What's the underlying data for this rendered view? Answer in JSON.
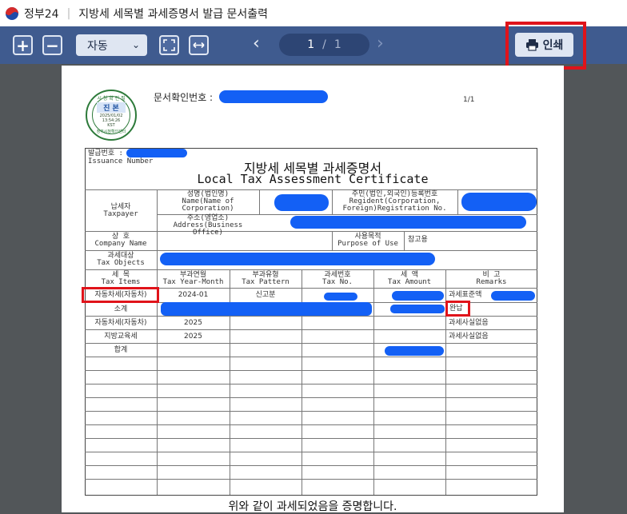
{
  "titlebar": {
    "app": "정부24",
    "doc_title": "지방세 세목별 과세증명서 발급 문서출력"
  },
  "toolbar": {
    "zoom_in": "+",
    "zoom_out": "−",
    "zoom_value": "자동",
    "page_current": "1",
    "page_total": "1",
    "print_label": "인쇄"
  },
  "document": {
    "confirm_label": "문서확인번호 :",
    "page_indicator": "1/1",
    "seal": {
      "top": "시 청 확 인 필",
      "mid": "진 본",
      "date": "2025/01/02",
      "time": "13:54:26",
      "tz": "KST",
      "bottom": "정부시청확인센터"
    },
    "issuance_label": "발급번호 :",
    "issuance_label_en": "Issuance Number",
    "title": "지방세 세목별 과세증명서",
    "subtitle": "Local Tax Assessment Certificate",
    "taxpayer": {
      "ko": "납세자",
      "en": "Taxpayer"
    },
    "name": {
      "ko": "성명(법인명)",
      "en1": "Name(Name of",
      "en2": "Corporation)"
    },
    "resident": {
      "ko": "주민(법인,외국인)등록번호",
      "en1": "Regident(Corporation,",
      "en2": "Foreign)Registration No."
    },
    "address": {
      "ko": "주소(영업소)",
      "en": "Address(Business Office)"
    },
    "company": {
      "ko": "상    호",
      "en": "Company Name"
    },
    "purpose": {
      "ko": "사용목적",
      "en": "Purpose of Use",
      "value": "참고용"
    },
    "tax_objects": {
      "ko": "과세대상",
      "en": "Tax Objects"
    },
    "headers": [
      {
        "ko": "세    목",
        "en": "Tax Items"
      },
      {
        "ko": "부과연월",
        "en": "Tax Year-Month"
      },
      {
        "ko": "부과유형",
        "en": "Tax Pattern"
      },
      {
        "ko": "과세번호",
        "en": "Tax No."
      },
      {
        "ko": "세    액",
        "en": "Tax Amount"
      },
      {
        "ko": "비    고",
        "en": "Remarks"
      }
    ],
    "rows": [
      {
        "item": "자동차세(자동차)",
        "ym": "2024-01",
        "pattern": "신고분",
        "remark": "과세표준액"
      },
      {
        "item": "소계",
        "ym": "",
        "pattern": "",
        "remark": "완납"
      },
      {
        "item": "자동차세(자동차)",
        "ym": "2025",
        "pattern": "",
        "remark": "과세사실없음"
      },
      {
        "item": "지방교육세",
        "ym": "2025",
        "pattern": "",
        "remark": "과세사실없음"
      },
      {
        "item": "합계",
        "ym": "",
        "pattern": "",
        "remark": ""
      }
    ],
    "footer": "위와 같이 과세되었음을 증명합니다."
  }
}
